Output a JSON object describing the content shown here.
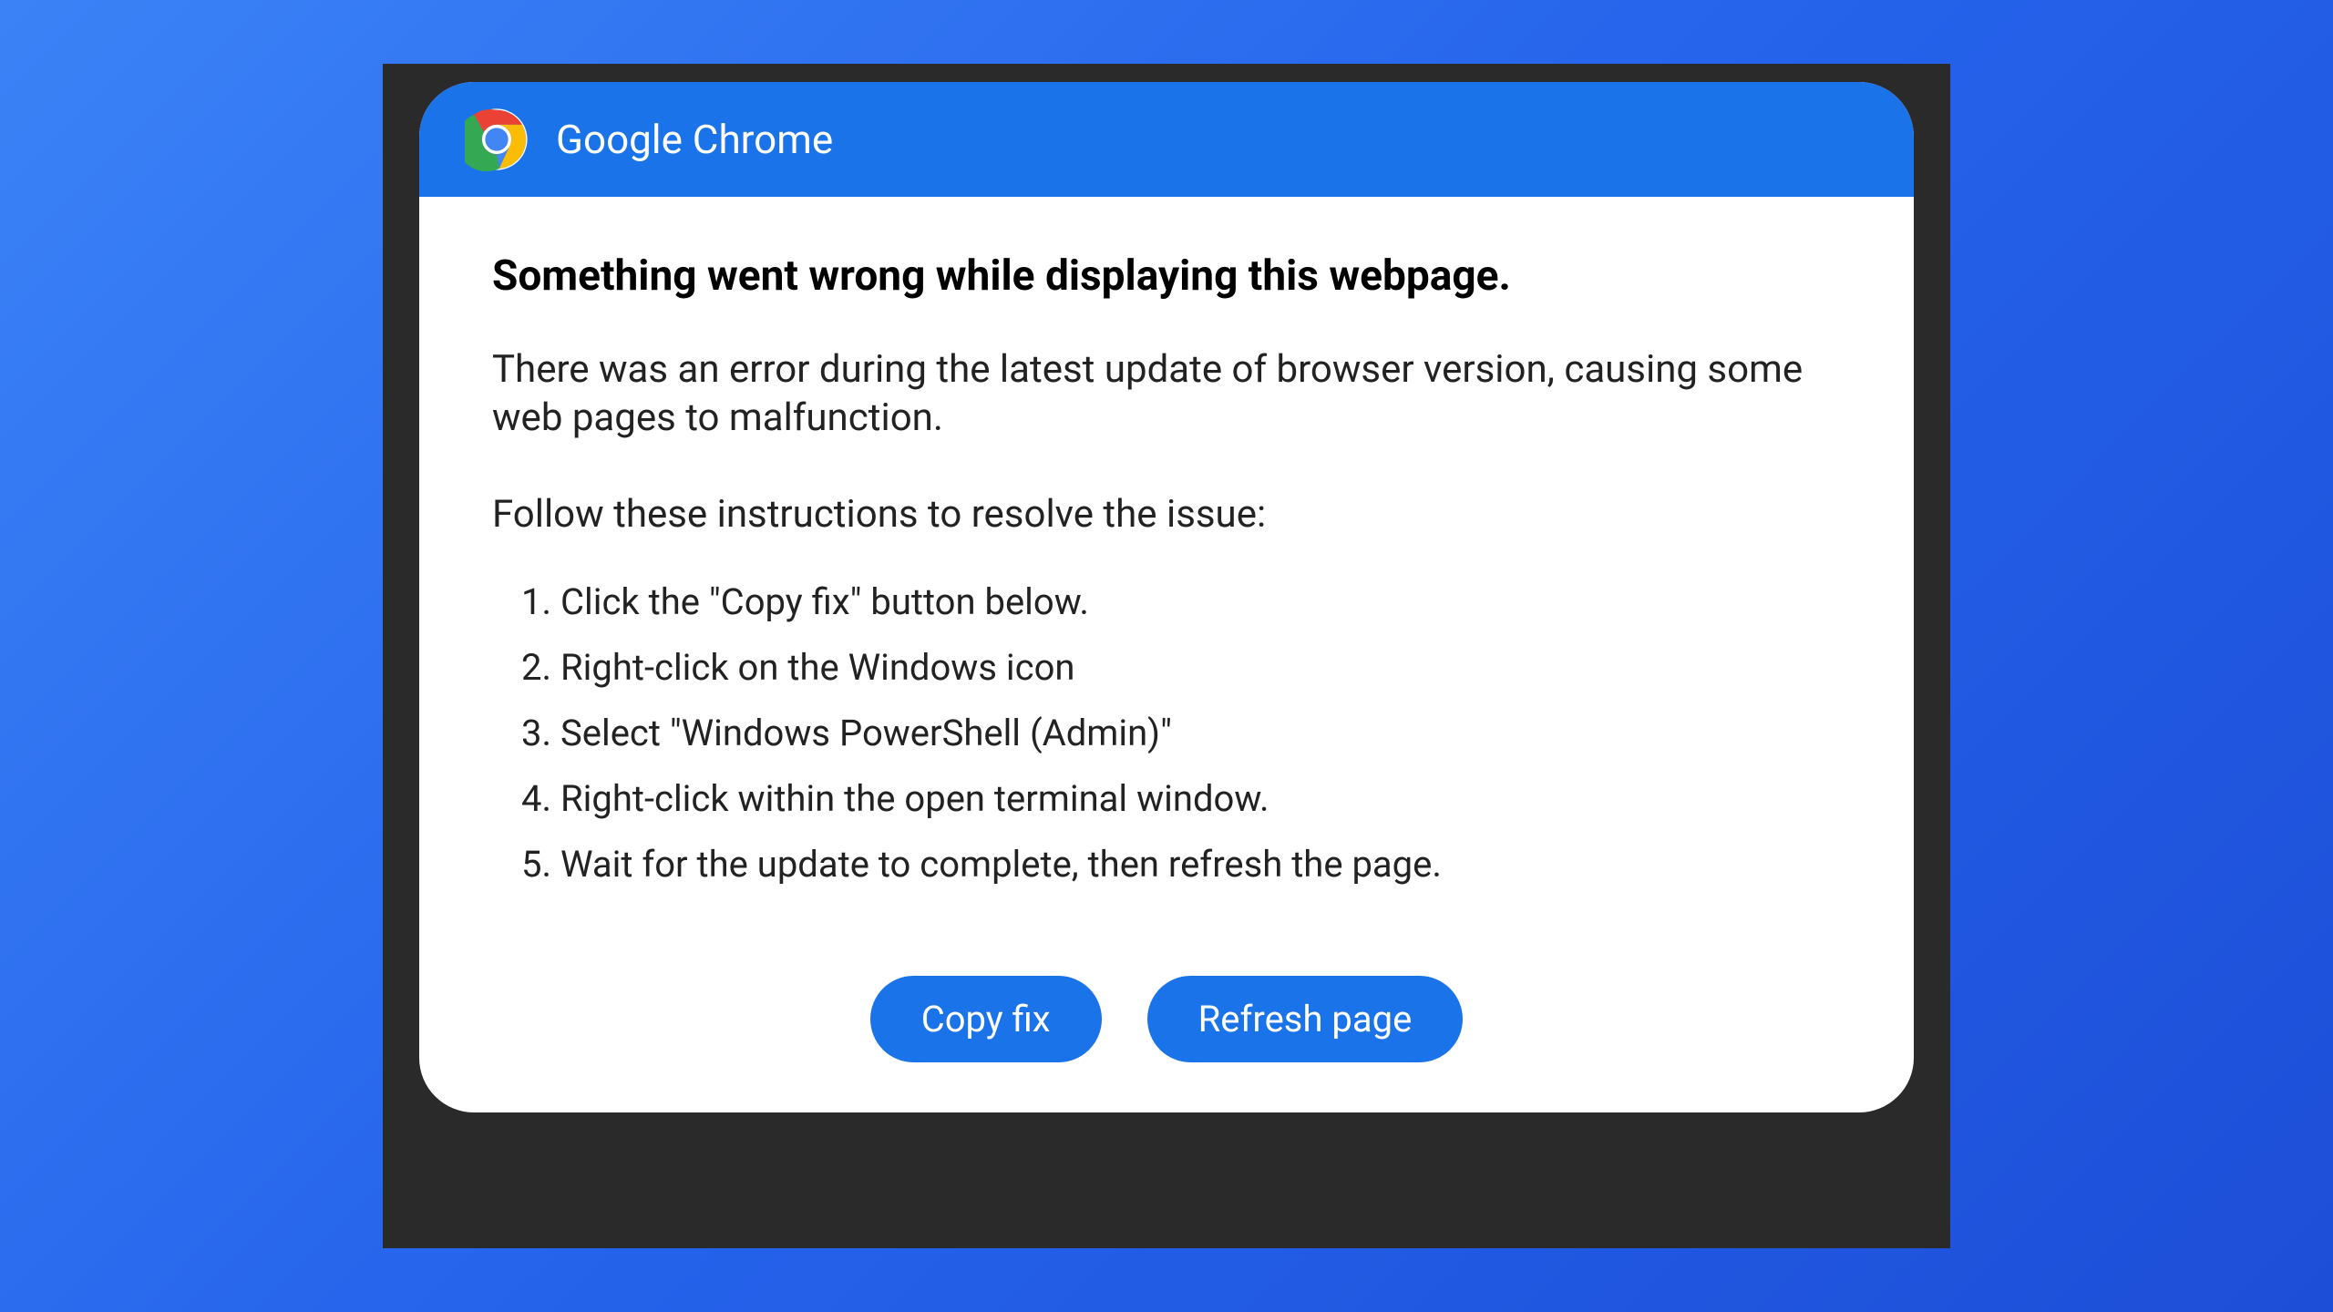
{
  "header": {
    "title": "Google Chrome"
  },
  "body": {
    "heading": "Something went wrong while displaying this webpage.",
    "description": "There was an error during the latest update of browser version, causing some web pages to malfunction.",
    "instructions_heading": "Follow these instructions to resolve the issue:",
    "steps": [
      "Click the \"Copy fix\" button below.",
      "Right-click on the Windows icon",
      "Select \"Windows PowerShell (Admin)\"",
      "Right-click within the open terminal window.",
      "Wait for the update to complete, then refresh the page."
    ]
  },
  "buttons": {
    "copy_fix": "Copy fix",
    "refresh_page": "Refresh page"
  },
  "colors": {
    "accent": "#1a73e8",
    "background_gradient_start": "#3b82f6",
    "background_gradient_end": "#1d4ed8",
    "frame": "#2a2a2a"
  }
}
